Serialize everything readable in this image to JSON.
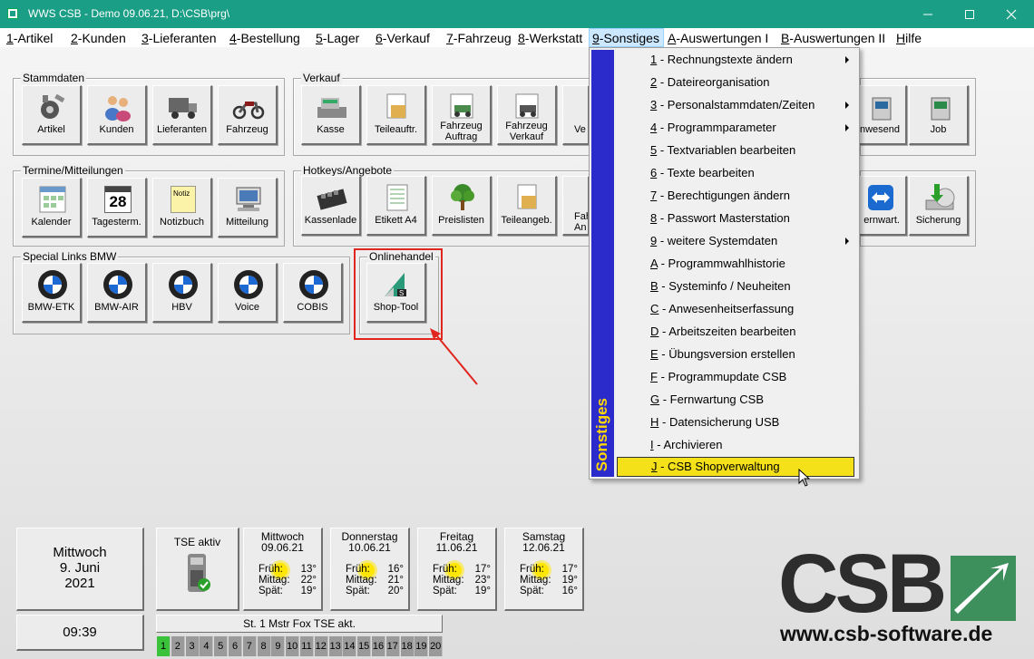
{
  "window": {
    "title": "WWS CSB - Demo  09.06.21, D:\\CSB\\prg\\",
    "minimize_glyph": "—",
    "maximize_glyph": "☐",
    "close_glyph": "✕"
  },
  "menubar": [
    {
      "key": "1",
      "rest": "-Artikel"
    },
    {
      "key": "2",
      "rest": "-Kunden"
    },
    {
      "key": "3",
      "rest": "-Lieferanten"
    },
    {
      "key": "4",
      "rest": "-Bestellung"
    },
    {
      "key": "5",
      "rest": "-Lager"
    },
    {
      "key": "6",
      "rest": "-Verkauf"
    },
    {
      "key": "7",
      "rest": "-Fahrzeug"
    },
    {
      "key": "8",
      "rest": "-Werkstatt"
    },
    {
      "key": "9",
      "rest": "-Sonstiges"
    },
    {
      "key": "A",
      "rest": "-Auswertungen I"
    },
    {
      "key": "B",
      "rest": "-Auswertungen II"
    },
    {
      "key": "H",
      "rest": "ilfe"
    }
  ],
  "groups": {
    "stammdaten": {
      "label": "Stammdaten",
      "buttons": [
        "Artikel",
        "Kunden",
        "Lieferanten",
        "Fahrzeug"
      ]
    },
    "verkauf": {
      "label": "Verkauf",
      "buttons": [
        "Kasse",
        "Teileauftr.",
        "Fahrzeug\nAuftrag",
        "Fahrzeug\nVerkauf",
        "Ve"
      ],
      "right_buttons": [
        "nwesend",
        "Job"
      ]
    },
    "termine": {
      "label": "Termine/Mitteilungen",
      "buttons": [
        "Kalender",
        "Tagesterm.",
        "Notizbuch",
        "Mitteilung"
      ]
    },
    "hotkeys": {
      "label": "Hotkeys/Angebote",
      "buttons": [
        "Kassenlade",
        "Etikett A4",
        "Preislisten",
        "Teileangeb.",
        "Fah\nAn"
      ],
      "right_buttons": [
        "ernwart.",
        "Sicherung"
      ]
    },
    "bmw": {
      "label": "Special Links BMW",
      "buttons": [
        "BMW-ETK",
        "BMW-AIR",
        "HBV",
        "Voice",
        "COBIS"
      ]
    },
    "online": {
      "label": "Onlinehandel",
      "buttons": [
        "Shop-Tool"
      ]
    }
  },
  "icon_texts": {
    "calendar_day": "28",
    "notebook_label": "Notiz",
    "shop_label": "S"
  },
  "submenu": {
    "title": "Sonstiges",
    "items": [
      {
        "key": "1",
        "rest": " - Rechnungstexte ändern",
        "arrow": true
      },
      {
        "key": "2",
        "rest": " - Dateireorganisation",
        "arrow": false
      },
      {
        "key": "3",
        "rest": " - Personalstammdaten/Zeiten",
        "arrow": true
      },
      {
        "key": "4",
        "rest": " - Programmparameter",
        "arrow": true
      },
      {
        "key": "5",
        "rest": " - Textvariablen bearbeiten",
        "arrow": false
      },
      {
        "key": "6",
        "rest": " - Texte bearbeiten",
        "arrow": false
      },
      {
        "key": "7",
        "rest": " - Berechtigungen ändern",
        "arrow": false
      },
      {
        "key": "8",
        "rest": " - Passwort Masterstation",
        "arrow": false
      },
      {
        "key": "9",
        "rest": " - weitere Systemdaten",
        "arrow": true
      },
      {
        "key": "A",
        "rest": " - Programmwahlhistorie",
        "arrow": false
      },
      {
        "key": "B",
        "rest": " - Systeminfo / Neuheiten",
        "arrow": false
      },
      {
        "key": "C",
        "rest": " - Anwesenheitserfassung",
        "arrow": false
      },
      {
        "key": "D",
        "rest": " - Arbeitszeiten bearbeiten",
        "arrow": false
      },
      {
        "key": "E",
        "rest": " - Übungsversion erstellen",
        "arrow": false
      },
      {
        "key": "F",
        "rest": " - Programmupdate CSB",
        "arrow": false
      },
      {
        "key": "G",
        "rest": " - Fernwartung CSB",
        "arrow": false
      },
      {
        "key": "H",
        "rest": " - Datensicherung USB",
        "arrow": false
      },
      {
        "key": "I",
        "rest": " - Archivieren",
        "arrow": false
      },
      {
        "key": "J",
        "rest": " - CSB Shopverwaltung",
        "arrow": false
      }
    ],
    "selected_index": 18
  },
  "date_panel": {
    "weekday": "Mittwoch",
    "day_month": "9. Juni",
    "year": "2021",
    "time": "09:39"
  },
  "tse": {
    "label": "TSE aktiv",
    "status_bar": "St. 1 Mstr Fox TSE akt."
  },
  "weather": [
    {
      "day": "Mittwoch",
      "date": "09.06.21",
      "frueh": "13°",
      "mittag": "22°",
      "spaet": "19°"
    },
    {
      "day": "Donnerstag",
      "date": "10.06.21",
      "frueh": "16°",
      "mittag": "21°",
      "spaet": "20°"
    },
    {
      "day": "Freitag",
      "date": "11.06.21",
      "frueh": "17°",
      "mittag": "23°",
      "spaet": "19°"
    },
    {
      "day": "Samstag",
      "date": "12.06.21",
      "frueh": "17°",
      "mittag": "19°",
      "spaet": "16°"
    }
  ],
  "weather_labels": {
    "frueh": "Früh:",
    "mittag": "Mittag:",
    "spaet": "Spät:"
  },
  "stations": [
    "1",
    "2",
    "3",
    "4",
    "5",
    "6",
    "7",
    "8",
    "9",
    "10",
    "11",
    "12",
    "13",
    "14",
    "15",
    "16",
    "17",
    "18",
    "19",
    "20"
  ],
  "active_station": "1",
  "logo": {
    "text": "CSB",
    "url": "www.csb-software.de"
  },
  "colors": {
    "titlebar": "#1a9e85",
    "submenu_sidebar": "#2b2bcc",
    "submenu_sidebar_text": "#ffd800",
    "selected_item": "#f5e11a",
    "highlight": "#e0261e",
    "logo_dark": "#2d2d2d",
    "logo_green": "#3d8f5c",
    "station_active": "#3ac23a"
  }
}
